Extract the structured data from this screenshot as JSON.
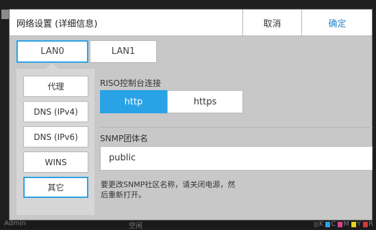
{
  "dialog": {
    "title": "网络设置 (详细信息)",
    "cancel_label": "取消",
    "ok_label": "确定"
  },
  "tabs": [
    {
      "label": "LAN0",
      "selected": true
    },
    {
      "label": "LAN1",
      "selected": false
    }
  ],
  "sidebar": {
    "items": [
      {
        "label": "代理"
      },
      {
        "label": "DNS (IPv4)"
      },
      {
        "label": "DNS (IPv6)"
      },
      {
        "label": "WINS"
      },
      {
        "label": "其它",
        "selected": true
      }
    ]
  },
  "content": {
    "riso_label": "RISO控制台连接",
    "protocol_options": [
      "http",
      "https"
    ],
    "protocol_selected": "http",
    "snmp_label": "SNMP团体名",
    "snmp_value": "public",
    "note": "要更改SNMP社区名称，请关闭电源，然后重新打开。"
  },
  "statusbar": {
    "user": "Admin",
    "state": "空闲",
    "inks": [
      "K",
      "C",
      "M",
      "Y",
      "R"
    ]
  },
  "colors": {
    "accent": "#2aa2e6",
    "ok_text": "#2b85c8",
    "ink_K": "#3a3a3a",
    "ink_C": "#2aa2e6",
    "ink_M": "#d6438f",
    "ink_Y": "#e8d21a",
    "ink_R": "#d23a3a"
  }
}
